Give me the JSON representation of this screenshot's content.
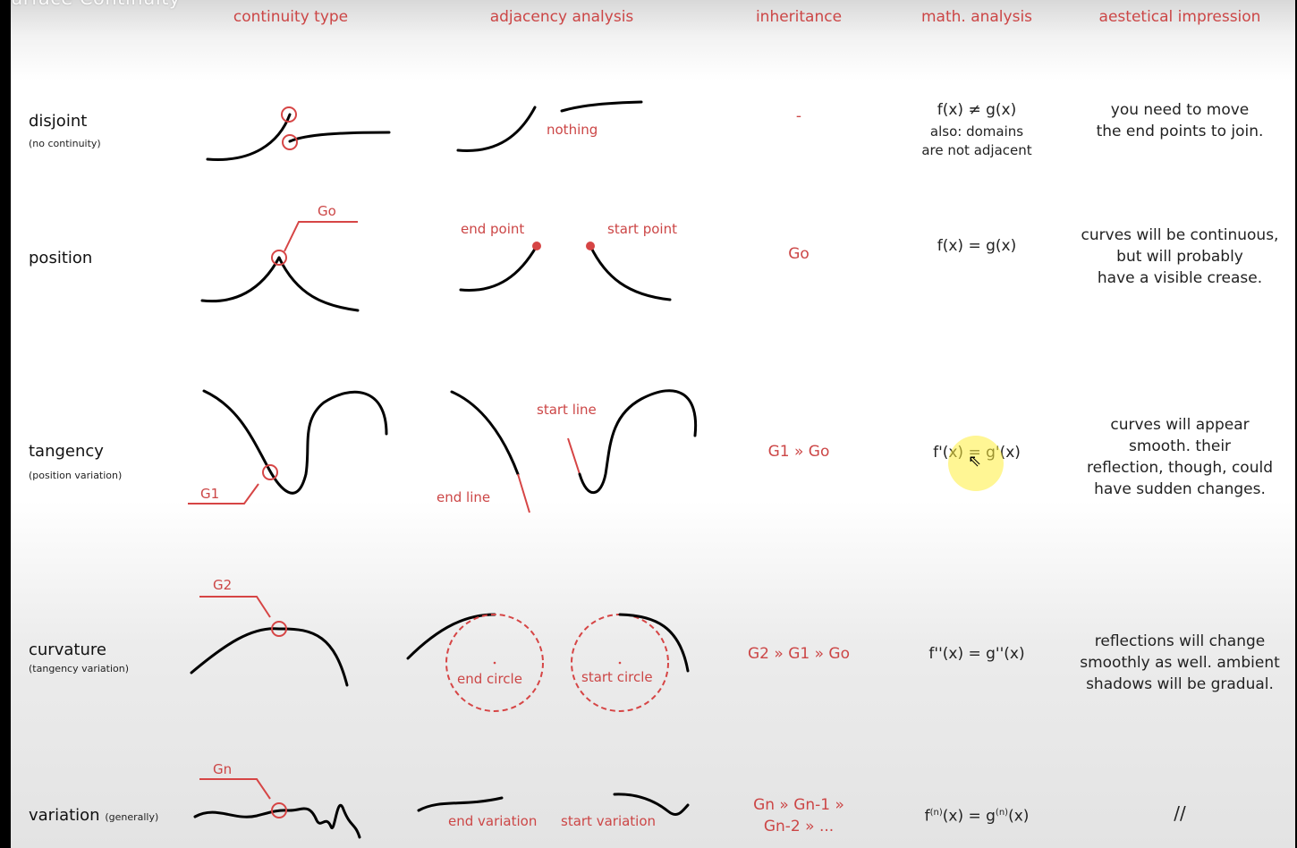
{
  "video_title": "urface Continuity",
  "headers": {
    "continuity_type": "continuity type",
    "adjacency": "adjacency analysis",
    "inheritance": "inheritance",
    "math": "math. analysis",
    "aesthetic": "aestetical impression"
  },
  "rows": {
    "disjoint": {
      "label": "disjoint",
      "sub": "(no continuity)",
      "adj_note": "nothing",
      "inheritance": "-",
      "math_1": "f(x) ≠ g(x)",
      "math_2": "also: domains",
      "math_3": "are not adjacent",
      "aes_1": "you need to move",
      "aes_2": "the end points to join."
    },
    "position": {
      "label": "position",
      "g_label": "Go",
      "adj_end": "end point",
      "adj_start": "start point",
      "inheritance": "Go",
      "math": "f(x) = g(x)",
      "aes_1": "curves will be continuous,",
      "aes_2": "but will probably",
      "aes_3": "have a visible crease."
    },
    "tangency": {
      "label": "tangency",
      "sub": "(position variation)",
      "g_label": "G1",
      "adj_end": "end line",
      "adj_start": "start line",
      "inheritance": "G1 » Go",
      "math": "f'(x) = g'(x)",
      "aes_1": "curves will appear",
      "aes_2": "smooth. their",
      "aes_3": "reflection, though, could",
      "aes_4": "have sudden changes."
    },
    "curvature": {
      "label": "curvature",
      "sub": "(tangency variation)",
      "g_label": "G2",
      "adj_end": "end circle",
      "adj_start": "start circle",
      "inheritance": "G2 » G1 » Go",
      "math": "f''(x) = g''(x)",
      "aes_1": "reflections will change",
      "aes_2": "smoothly as well. ambient",
      "aes_3": "shadows will be gradual."
    },
    "variation": {
      "label": "variation",
      "sub": "(generally)",
      "g_label": "Gn",
      "adj_end": "end variation",
      "adj_start": "start variation",
      "inheritance_1": "Gn » Gn-1 »",
      "inheritance_2": "Gn-2 » ...",
      "math_f": "f",
      "math_sup": "(n)",
      "math_mid": "(x) = g",
      "math_sup2": "(n)",
      "math_end": "(x)",
      "aesthetic": "//"
    }
  },
  "colors": {
    "accent": "#cc4646",
    "curve": "#000000",
    "highlight": "#ffee3c"
  }
}
